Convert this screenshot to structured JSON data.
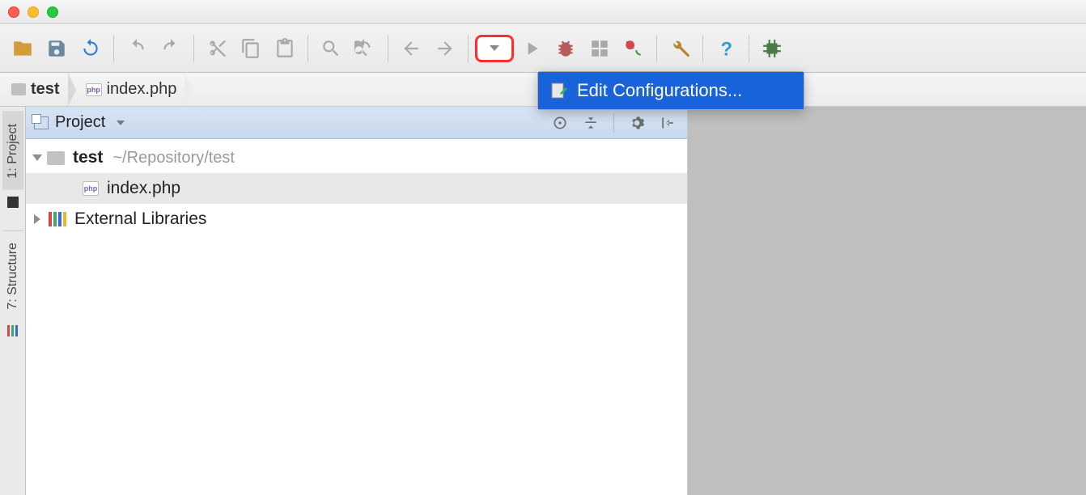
{
  "breadcrumb": {
    "items": [
      {
        "label": "test",
        "icon": "folder"
      },
      {
        "label": "index.php",
        "icon": "php"
      }
    ]
  },
  "dropdown": {
    "editConfigurations": "Edit Configurations..."
  },
  "projectPanel": {
    "title": "Project",
    "tree": {
      "root": {
        "name": "test",
        "path": "~/Repository/test"
      },
      "file": {
        "name": "index.php"
      },
      "externalLibs": "External Libraries"
    }
  },
  "leftTabs": {
    "project": "1: Project",
    "structure": "7: Structure"
  }
}
